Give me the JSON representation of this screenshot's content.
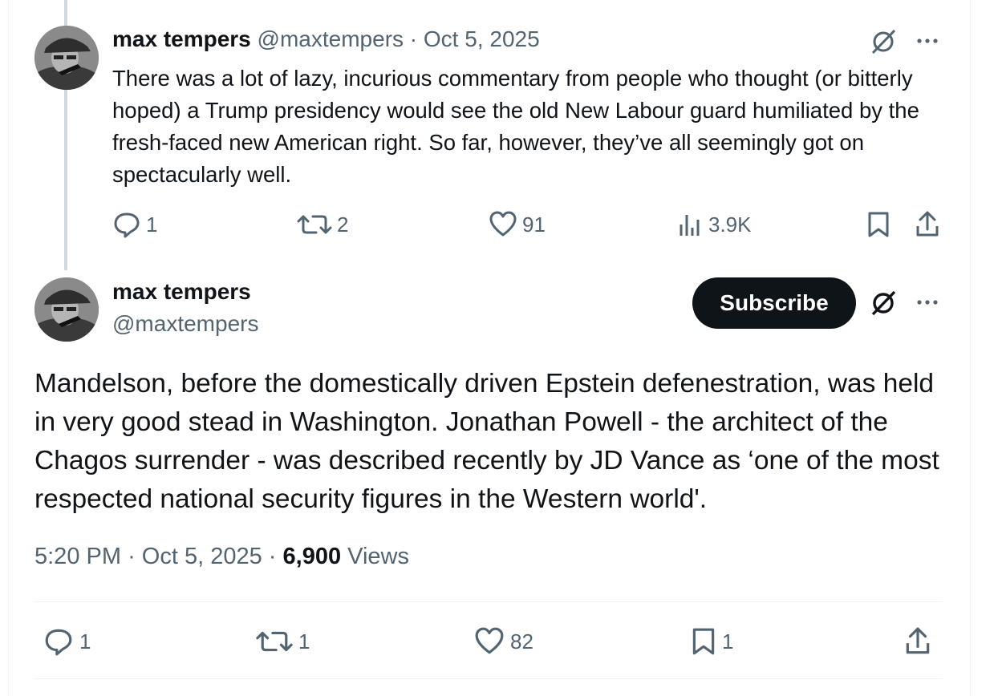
{
  "reply": {
    "author_name": "max tempers",
    "author_handle": "@maxtempers",
    "separator": "·",
    "date": "Oct 5, 2025",
    "text": "There was a lot of lazy, incurious commentary from people who thought (or bitterly hoped) a Trump presidency would see the old New Labour guard humiliated by the fresh-faced new American right. So far, however, they’ve all seemingly got on spectacularly well.",
    "stats": {
      "replies": "1",
      "reposts": "2",
      "likes": "91",
      "views": "3.9K"
    }
  },
  "main": {
    "author_name": "max tempers",
    "author_handle": "@maxtempers",
    "subscribe_label": "Subscribe",
    "text": "Mandelson, before the domestically driven Epstein defenestration, was held in very good stead in Washington. Jonathan Powell - the architect of the Chagos surrender - was described recently by JD Vance as ‘one of the most respected national security figures in the Western world'.",
    "time": "5:20 PM",
    "date": "Oct 5, 2025",
    "separator": "·",
    "views_count": "6,900",
    "views_label": "Views",
    "stats": {
      "replies": "1",
      "reposts": "1",
      "likes": "82",
      "bookmarks": "1"
    }
  },
  "icons": {
    "reply": "reply-icon",
    "repost": "repost-icon",
    "like": "heart-icon",
    "views": "views-icon",
    "bookmark": "bookmark-icon",
    "share": "share-icon",
    "grok": "grok-icon",
    "more": "more-icon"
  },
  "colors": {
    "text": "#0f1419",
    "secondary": "#536471",
    "thread_line": "#cfd9de",
    "button": "#0f1419"
  }
}
